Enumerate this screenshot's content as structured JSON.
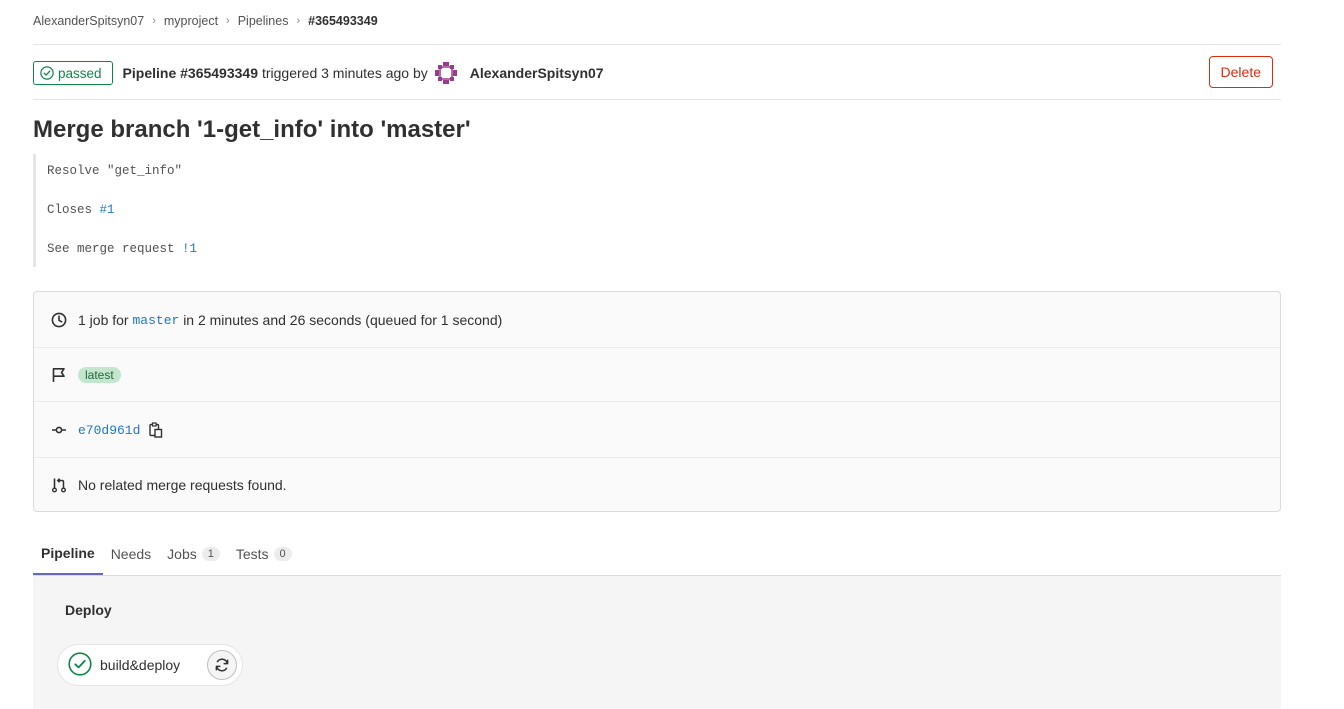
{
  "breadcrumb": {
    "items": [
      "AlexanderSpitsyn07",
      "myproject",
      "Pipelines"
    ],
    "current": "#365493349"
  },
  "header": {
    "status": "passed",
    "pipeline_label": "Pipeline #365493349",
    "triggered_text": "triggered 3 minutes ago by",
    "author": "AlexanderSpitsyn07",
    "delete_label": "Delete"
  },
  "commit": {
    "title": "Merge branch '1-get_info' into 'master'",
    "desc_line1": "Resolve \"get_info\"",
    "desc_line2_prefix": "Closes ",
    "desc_line2_link": "#1",
    "desc_line3_prefix": "See merge request ",
    "desc_line3_link": "!1"
  },
  "info": {
    "jobs_prefix": "1 job for",
    "branch": "master",
    "jobs_suffix": "in 2 minutes and 26 seconds (queued for 1 second)",
    "badge": "latest",
    "sha": "e70d961d",
    "mr_text": "No related merge requests found."
  },
  "tabs": [
    {
      "label": "Pipeline"
    },
    {
      "label": "Needs"
    },
    {
      "label": "Jobs",
      "count": "1"
    },
    {
      "label": "Tests",
      "count": "0"
    }
  ],
  "graph": {
    "stage": "Deploy",
    "job": "build&deploy"
  },
  "colors": {
    "success": "#108548",
    "danger": "#dd2b0e",
    "link": "#1f75cb",
    "tab_active": "#6666c4"
  },
  "icons": [
    "check-circle-icon",
    "clock-icon",
    "flag-icon",
    "commit-icon",
    "copy-icon",
    "merge-request-icon",
    "retry-icon",
    "avatar-identicon"
  ]
}
